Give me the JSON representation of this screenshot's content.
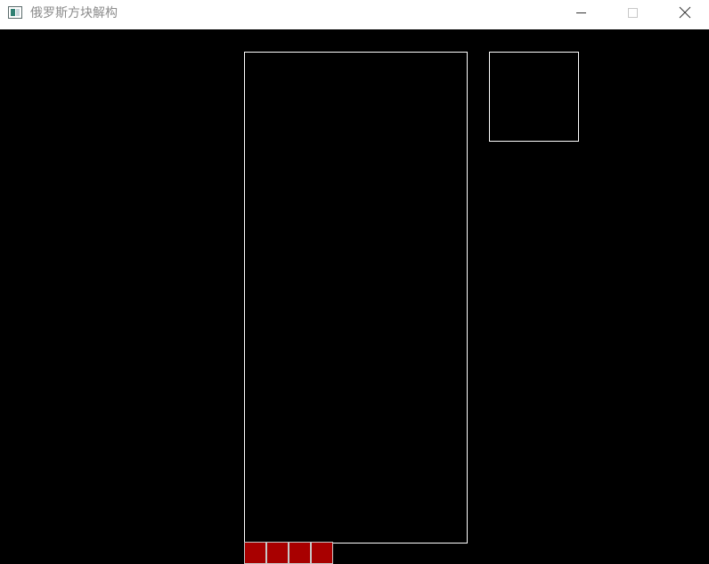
{
  "window": {
    "title": "俄罗斯方块解构",
    "icon": "app-window-icon",
    "controls": [
      "minimize-icon",
      "maximize-icon",
      "close-icon"
    ]
  },
  "game": {
    "board": {
      "columns": 10,
      "border_color": "#ffffff"
    },
    "next_preview": {
      "border_color": "#ffffff",
      "piece": null
    },
    "falling_piece": {
      "shape": "I",
      "color": "#a80000",
      "cells": [
        [
          0,
          0
        ],
        [
          1,
          0
        ],
        [
          2,
          0
        ],
        [
          3,
          0
        ]
      ]
    }
  }
}
